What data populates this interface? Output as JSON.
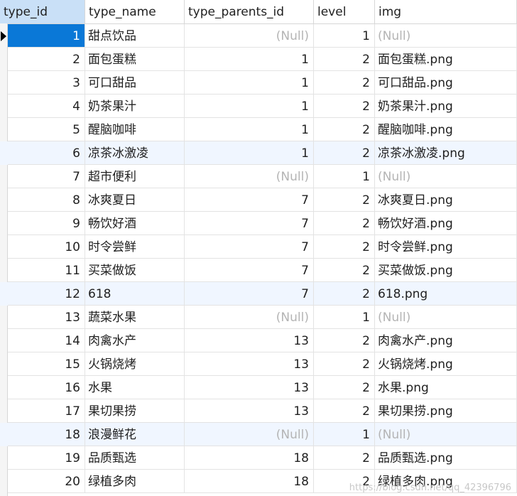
{
  "columns": [
    "type_id",
    "type_name",
    "type_parents_id",
    "level",
    "img"
  ],
  "null_label": "(Null)",
  "rows": [
    {
      "type_id": "1",
      "type_name": "甜点饮品",
      "type_parents_id": null,
      "level": "1",
      "img": null
    },
    {
      "type_id": "2",
      "type_name": "面包蛋糕",
      "type_parents_id": "1",
      "level": "2",
      "img": "面包蛋糕.png"
    },
    {
      "type_id": "3",
      "type_name": "可口甜品",
      "type_parents_id": "1",
      "level": "2",
      "img": "可口甜品.png"
    },
    {
      "type_id": "4",
      "type_name": "奶茶果汁",
      "type_parents_id": "1",
      "level": "2",
      "img": "奶茶果汁.png"
    },
    {
      "type_id": "5",
      "type_name": "醒脑咖啡",
      "type_parents_id": "1",
      "level": "2",
      "img": "醒脑咖啡.png"
    },
    {
      "type_id": "6",
      "type_name": "凉茶冰激凌",
      "type_parents_id": "1",
      "level": "2",
      "img": "凉茶冰激凌.png"
    },
    {
      "type_id": "7",
      "type_name": "超市便利",
      "type_parents_id": null,
      "level": "1",
      "img": null
    },
    {
      "type_id": "8",
      "type_name": "冰爽夏日",
      "type_parents_id": "7",
      "level": "2",
      "img": "冰爽夏日.png"
    },
    {
      "type_id": "9",
      "type_name": "畅饮好酒",
      "type_parents_id": "7",
      "level": "2",
      "img": "畅饮好酒.png"
    },
    {
      "type_id": "10",
      "type_name": "时令尝鲜",
      "type_parents_id": "7",
      "level": "2",
      "img": "时令尝鲜.png"
    },
    {
      "type_id": "11",
      "type_name": "买菜做饭",
      "type_parents_id": "7",
      "level": "2",
      "img": "买菜做饭.png"
    },
    {
      "type_id": "12",
      "type_name": "618",
      "type_parents_id": "7",
      "level": "2",
      "img": "618.png"
    },
    {
      "type_id": "13",
      "type_name": "蔬菜水果",
      "type_parents_id": null,
      "level": "1",
      "img": null
    },
    {
      "type_id": "14",
      "type_name": "肉禽水产",
      "type_parents_id": "13",
      "level": "2",
      "img": "肉禽水产.png"
    },
    {
      "type_id": "15",
      "type_name": "火锅烧烤",
      "type_parents_id": "13",
      "level": "2",
      "img": "火锅烧烤.png"
    },
    {
      "type_id": "16",
      "type_name": "水果",
      "type_parents_id": "13",
      "level": "2",
      "img": "水果.png"
    },
    {
      "type_id": "17",
      "type_name": "果切果捞",
      "type_parents_id": "13",
      "level": "2",
      "img": "果切果捞.png"
    },
    {
      "type_id": "18",
      "type_name": "浪漫鲜花",
      "type_parents_id": null,
      "level": "1",
      "img": null
    },
    {
      "type_id": "19",
      "type_name": "品质甄选",
      "type_parents_id": "18",
      "level": "2",
      "img": "品质甄选.png"
    },
    {
      "type_id": "20",
      "type_name": "绿植多肉",
      "type_parents_id": "18",
      "level": "2",
      "img": "绿植多肉.png"
    }
  ],
  "watermark": "https://blog.csdn.net/qq_42396796",
  "colors": {
    "selection": "#0a78d7",
    "header_selected": "#c9e0f7",
    "null_text": "#b4b4b4",
    "alt_row": "#f0f6ff"
  }
}
